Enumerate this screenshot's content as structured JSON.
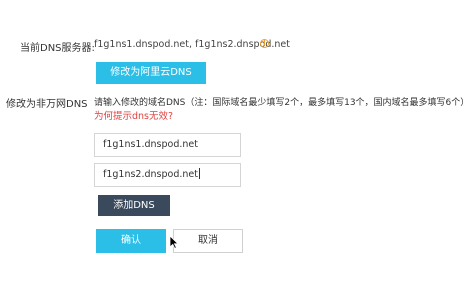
{
  "current_dns": {
    "label": "当前DNS服务器:",
    "value": "f1g1ns1.dnspod.net, f1g1ns2.dnspod.net",
    "info_icon": "info-circle-icon",
    "switch_button_label": "修改为阿里云DNS"
  },
  "modify": {
    "label": "修改为非万网DNS",
    "instruction": "请输入修改的域名DNS（注：国际域名最少填写2个，最多填写13个，国内域名最多填写6个）",
    "hint_link": "为何提示dns无效?",
    "inputs": [
      {
        "value": "f1g1ns1.dnspod.net"
      },
      {
        "value": "f1g1ns2.dnspod.net"
      }
    ],
    "add_button_label": "添加DNS"
  },
  "actions": {
    "confirm_label": "确认",
    "cancel_label": "取消"
  },
  "colors": {
    "primary": "#2bbfe8",
    "dark_button": "#3a4a5c",
    "warning_link": "#e0413f",
    "info_icon": "#e6a23c"
  }
}
